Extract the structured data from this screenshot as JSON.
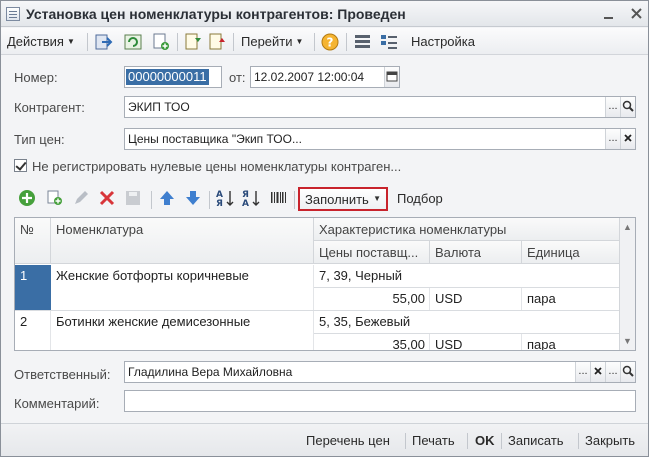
{
  "window": {
    "title": "Установка цен номенклатуры контрагентов: Проведен"
  },
  "toolbar": {
    "actions_label": "Действия",
    "goto_label": "Перейти",
    "settings_label": "Настройка"
  },
  "form": {
    "number_label": "Номер:",
    "number_value": "00000000011",
    "date_label": "от:",
    "date_value": "12.02.2007 12:00:04",
    "counterparty_label": "Контрагент:",
    "counterparty_value": "ЭКИП ТОО",
    "price_type_label": "Тип цен:",
    "price_type_value": "Цены поставщика \"Экип ТОО...",
    "checkbox_label": "Не регистрировать нулевые цены номенклатуры контраген...",
    "responsible_label": "Ответственный:",
    "responsible_value": "Гладилина Вера Михайловна",
    "comment_label": "Комментарий:",
    "comment_value": ""
  },
  "table_toolbar": {
    "fill_label": "Заполнить",
    "select_label": "Подбор"
  },
  "table": {
    "headers": {
      "num": "№",
      "item": "Номенклатура",
      "characteristic": "Характеристика номенклатуры",
      "price": "Цены поставщ...",
      "currency": "Валюта",
      "unit": "Единица"
    },
    "rows": [
      {
        "num": "1",
        "item": "Женские ботфорты коричневые",
        "characteristic": "7, 39, Черный",
        "price": "55,00",
        "currency": "USD",
        "unit": "пара"
      },
      {
        "num": "2",
        "item": "Ботинки женские демисезонные",
        "characteristic": "5, 35, Бежевый",
        "price": "35,00",
        "currency": "USD",
        "unit": "пара"
      }
    ]
  },
  "footer": {
    "price_list": "Перечень цен",
    "print": "Печать",
    "ok": "OK",
    "save": "Записать",
    "close": "Закрыть"
  },
  "colors": {
    "selection": "#3a6ea5",
    "fill_highlight": "#c8232c"
  }
}
